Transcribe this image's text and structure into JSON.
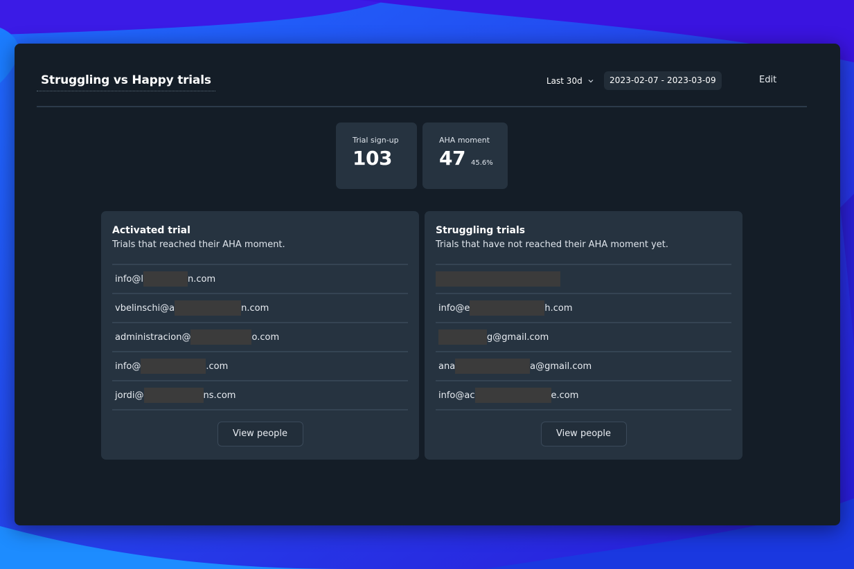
{
  "header": {
    "title": "Struggling vs Happy trials",
    "range_label": "Last 30d",
    "date_range": "2023-02-07 - 2023-03-09",
    "edit_label": "Edit"
  },
  "metrics": [
    {
      "label": "Trial sign-up",
      "value": "103",
      "percent": ""
    },
    {
      "label": "AHA moment",
      "value": "47",
      "percent": "45.6%"
    }
  ],
  "cards": [
    {
      "title": "Activated trial",
      "subtitle": "Trials that reached their AHA moment.",
      "button_label": "View people",
      "rows": [
        {
          "prefix": "info@l",
          "suffix": "n.com"
        },
        {
          "prefix": "vbelinschi@a",
          "suffix": "n.com"
        },
        {
          "prefix": "administracion@",
          "suffix": "o.com"
        },
        {
          "prefix": "info@",
          "suffix": ".com"
        },
        {
          "prefix": "jordi@",
          "suffix": "ns.com"
        }
      ]
    },
    {
      "title": "Struggling trials",
      "subtitle": "Trials that have not reached their AHA moment yet.",
      "button_label": "View people",
      "rows": [
        {
          "prefix": "",
          "suffix": ""
        },
        {
          "prefix": "info@e",
          "suffix": "h.com"
        },
        {
          "prefix": "",
          "suffix": "g@gmail.com"
        },
        {
          "prefix": "ana",
          "suffix": "a@gmail.com"
        },
        {
          "prefix": "info@ac",
          "suffix": "e.com"
        }
      ]
    }
  ]
}
